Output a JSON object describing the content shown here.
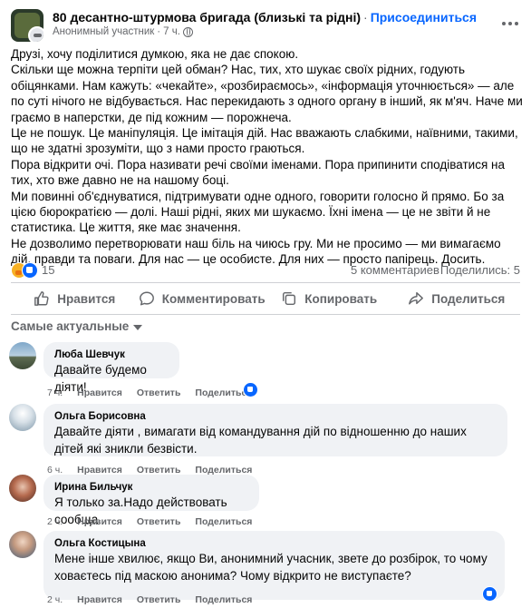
{
  "post": {
    "group_name": "80 десантно-штурмова бригада (близькі та рідні)",
    "separator": "·",
    "join_label": "Присоединиться",
    "author": "Анонимный участник",
    "time": "7 ч.",
    "body_lines": [
      "Друзі, хочу поділитися думкою, яка не дає спокою.",
      "Скільки ще можна терпіти цей обман? Нас, тих, хто шукає своїх рідних, годують обіцянками. Нам кажуть: «чекайте», «розбираємось», «інформація уточнюється» — але по суті нічого не відбувається. Нас перекидають з одного органу в інший, як м'яч. Наче ми граємо в наперстки, де під кожним — порожнеча.",
      "Це не пошук. Це маніпуляція. Це імітація дій. Нас вважають слабкими, наївними, такими, що не здатні зрозуміти, що з нами просто граються.",
      "Пора відкрити очі. Пора називати речі своїми іменами. Пора припинити сподіватися на тих, хто вже давно не на нашому боці.",
      "Ми повинні об'єднуватися, підтримувати одне одного, говорити голосно й прямо. Бо за цією бюрократією — долі. Наші рідні, яких ми шукаємо. Їхні імена — це не звіти й не статистика. Це життя, яке має значення.",
      "Не дозволимо перетворювати наш біль на чиюсь гру. Ми не просимо — ми вимагаємо дій, правди та поваги. Для нас — це особисте. Для них — просто папірець. Досить."
    ],
    "reaction_count": "15",
    "comments_count": "5 комментариев",
    "shares_count": "Поделились: 5"
  },
  "actions": {
    "like": "Нравится",
    "comment": "Комментировать",
    "copy": "Копировать",
    "share": "Поделиться"
  },
  "sort_label": "Самые актуальные",
  "comments": [
    {
      "name": "Люба Шевчук",
      "text": "Давайте будемо діяти!",
      "time": "7 ч.",
      "like": "Нравится",
      "reply": "Ответить",
      "share": "Поделиться",
      "has_reaction": true
    },
    {
      "name": "Ольга Борисовна",
      "text": "Давайте діяти , вимагати від командування дій по відношенню до наших дітей які зникли безвісти.",
      "time": "6 ч.",
      "like": "Нравится",
      "reply": "Ответить",
      "share": "Поделиться",
      "has_reaction": false
    },
    {
      "name": "Ирина Бильчук",
      "text": "Я только за.Надо действовать сообща.",
      "time": "2 ч.",
      "like": "Нравится",
      "reply": "Ответить",
      "share": "Поделиться",
      "has_reaction": false
    },
    {
      "name": "Ольга Костицына",
      "text": "Мене інше хвилює, якщо Ви, анонимний учасник, звете до розбірок, то чому ховаєтесь під маскою анонима? Чому відкрито не виступаєте?",
      "time": "2 ч.",
      "like": "Нравится",
      "reply": "Ответить",
      "share": "Поделиться",
      "has_reaction": true
    }
  ],
  "colors": {
    "accent": "#0866ff",
    "secondary_text": "#65676b",
    "bubble": "#f0f2f5"
  }
}
